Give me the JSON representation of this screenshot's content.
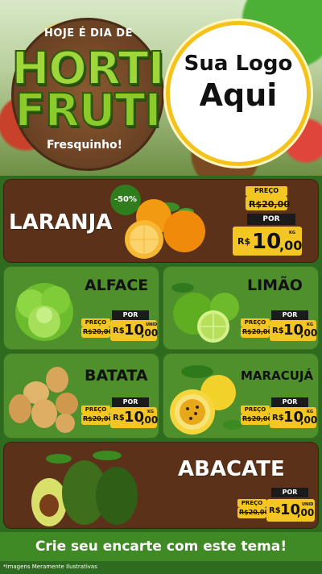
{
  "header": {
    "subtitle_top": "HOJE É DIA DE",
    "title_line1": "HORTI",
    "title_line2": "FRUTI",
    "tagline": "Fresquinho!",
    "logo_line1": "Sua Logo",
    "logo_line2": "Aqui"
  },
  "products": {
    "laranja": {
      "name": "LARANJA",
      "discount": "-50%",
      "preco_label": "PREÇO",
      "old_price": "R$20,00",
      "por_label": "POR",
      "currency": "R$",
      "price_int": "10",
      "price_cents": ",00",
      "unit": "KG"
    },
    "alface": {
      "name": "ALFACE",
      "preco_label": "PREÇO",
      "old_price": "R$20,00",
      "por_label": "POR",
      "currency": "R$",
      "price_int": "10",
      "price_cents": ",00",
      "unit": "UNID"
    },
    "limao": {
      "name": "LIMÃO",
      "preco_label": "PREÇO",
      "old_price": "R$20,00",
      "por_label": "POR",
      "currency": "R$",
      "price_int": "10",
      "price_cents": ",00",
      "unit": "KG"
    },
    "batata": {
      "name": "BATATA",
      "preco_label": "PREÇO",
      "old_price": "R$20,00",
      "por_label": "POR",
      "currency": "R$",
      "price_int": "10",
      "price_cents": ",00",
      "unit": "KG"
    },
    "maracuja": {
      "name": "MARACUJÁ",
      "preco_label": "PREÇO",
      "old_price": "R$20,00",
      "por_label": "POR",
      "currency": "R$",
      "price_int": "10",
      "price_cents": ",00",
      "unit": "KG"
    },
    "abacate": {
      "name": "ABACATE",
      "preco_label": "PREÇO",
      "old_price": "R$20,00",
      "por_label": "POR",
      "currency": "R$",
      "price_int": "10",
      "price_cents": ",00",
      "unit": "UNID"
    }
  },
  "footer": {
    "cta": "Crie seu encarte com este tema!",
    "note": "*Imagens Meramente Ilustrativas"
  },
  "colors": {
    "brown_card": "#5b3219",
    "green_card": "#4f8f2c",
    "price_yellow": "#f3c623",
    "title_green": "#9fd63a"
  }
}
